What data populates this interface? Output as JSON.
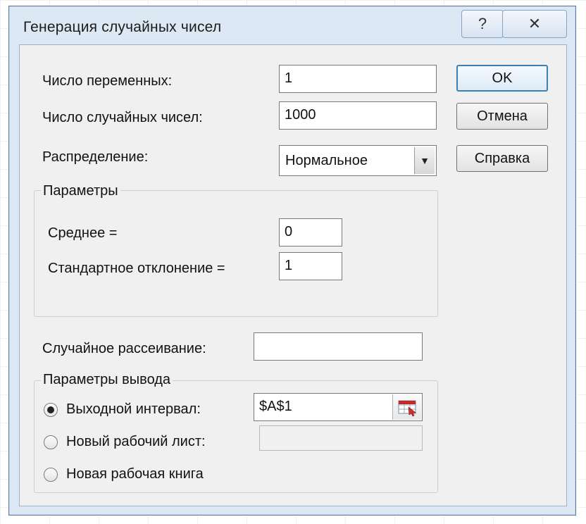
{
  "window": {
    "title": "Генерация случайных чисел",
    "help_symbol": "?",
    "close_symbol": "✕"
  },
  "fields": {
    "num_variables": {
      "label": "Число переменных:",
      "value": "1"
    },
    "num_random": {
      "label": "Число случайных чисел:",
      "value": "1000"
    },
    "distribution": {
      "label": "Распределение:",
      "value": "Нормальное"
    }
  },
  "parameters": {
    "title": "Параметры",
    "mean": {
      "label": "Среднее =",
      "value": "0"
    },
    "stddev": {
      "label": "Стандартное отклонение =",
      "value": "1"
    }
  },
  "seed": {
    "label": "Случайное рассеивание:",
    "value": ""
  },
  "output": {
    "title": "Параметры вывода",
    "options": [
      {
        "label": "Выходной интервал:",
        "checked": true,
        "value": "$A$1"
      },
      {
        "label": "Новый рабочий лист:",
        "checked": false,
        "value": ""
      },
      {
        "label": "Новая рабочая книга",
        "checked": false
      }
    ]
  },
  "buttons": {
    "ok": "OK",
    "cancel": "Отмена",
    "help": "Справка"
  },
  "icons": {
    "help": "help-icon",
    "close": "close-icon",
    "dropdown": "chevron-down-icon",
    "range_select": "range-select-icon"
  },
  "colors": {
    "dialog_frame": "#dde8f5",
    "client_bg": "#f0f0f0",
    "default_button_border": "#3c7fb1"
  }
}
